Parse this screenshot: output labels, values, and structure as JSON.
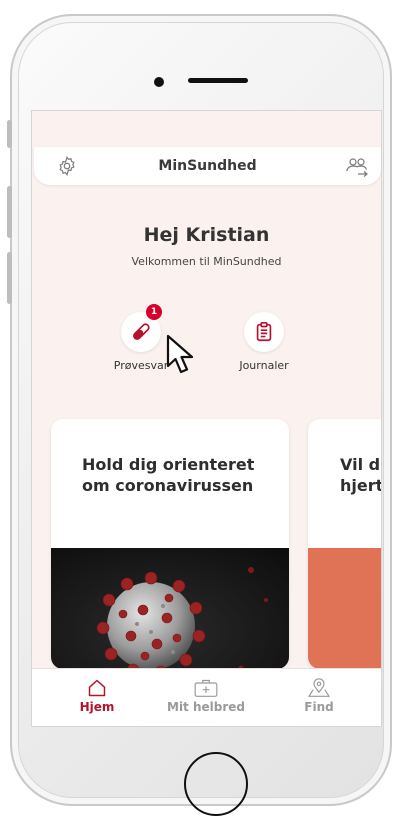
{
  "header": {
    "title": "MinSundhed",
    "left_icon": "gear-icon",
    "right_icon": "switch-user-icon"
  },
  "greeting": {
    "title": "Hej Kristian",
    "subtitle": "Velkommen til MinSundhed"
  },
  "shortcuts": [
    {
      "label": "Prøvesvar",
      "icon": "test-tube-icon",
      "badge": "1"
    },
    {
      "label": "Journaler",
      "icon": "clipboard-icon"
    }
  ],
  "cards": [
    {
      "title_line1": "Hold dig orienteret",
      "title_line2": "om coronavirussen"
    },
    {
      "title_line1": "Vil du",
      "title_line2": "hjerte"
    }
  ],
  "tabs": [
    {
      "label": "Hjem",
      "icon": "home-icon",
      "active": true
    },
    {
      "label": "Mit helbred",
      "icon": "medical-kit-icon",
      "active": false
    },
    {
      "label": "Find",
      "icon": "map-pin-icon",
      "active": false
    }
  ],
  "colors": {
    "accent": "#b5122b",
    "background": "#fbf2ef",
    "card_orange": "#e07356",
    "inactive": "#9a9a9a"
  }
}
